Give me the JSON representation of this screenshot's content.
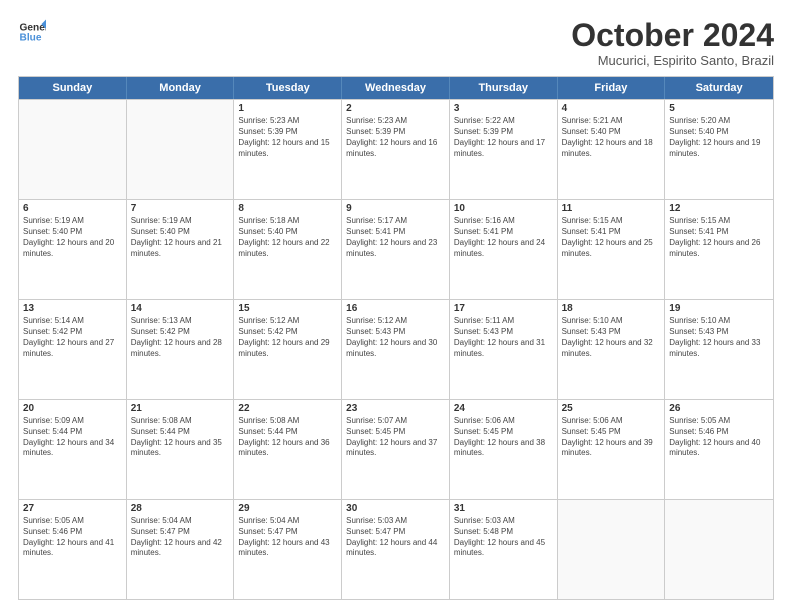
{
  "logo": {
    "line1": "General",
    "line2": "Blue"
  },
  "title": "October 2024",
  "subtitle": "Mucurici, Espirito Santo, Brazil",
  "header_days": [
    "Sunday",
    "Monday",
    "Tuesday",
    "Wednesday",
    "Thursday",
    "Friday",
    "Saturday"
  ],
  "weeks": [
    [
      {
        "day": "",
        "info": ""
      },
      {
        "day": "",
        "info": ""
      },
      {
        "day": "1",
        "info": "Sunrise: 5:23 AM\nSunset: 5:39 PM\nDaylight: 12 hours and 15 minutes."
      },
      {
        "day": "2",
        "info": "Sunrise: 5:23 AM\nSunset: 5:39 PM\nDaylight: 12 hours and 16 minutes."
      },
      {
        "day": "3",
        "info": "Sunrise: 5:22 AM\nSunset: 5:39 PM\nDaylight: 12 hours and 17 minutes."
      },
      {
        "day": "4",
        "info": "Sunrise: 5:21 AM\nSunset: 5:40 PM\nDaylight: 12 hours and 18 minutes."
      },
      {
        "day": "5",
        "info": "Sunrise: 5:20 AM\nSunset: 5:40 PM\nDaylight: 12 hours and 19 minutes."
      }
    ],
    [
      {
        "day": "6",
        "info": "Sunrise: 5:19 AM\nSunset: 5:40 PM\nDaylight: 12 hours and 20 minutes."
      },
      {
        "day": "7",
        "info": "Sunrise: 5:19 AM\nSunset: 5:40 PM\nDaylight: 12 hours and 21 minutes."
      },
      {
        "day": "8",
        "info": "Sunrise: 5:18 AM\nSunset: 5:40 PM\nDaylight: 12 hours and 22 minutes."
      },
      {
        "day": "9",
        "info": "Sunrise: 5:17 AM\nSunset: 5:41 PM\nDaylight: 12 hours and 23 minutes."
      },
      {
        "day": "10",
        "info": "Sunrise: 5:16 AM\nSunset: 5:41 PM\nDaylight: 12 hours and 24 minutes."
      },
      {
        "day": "11",
        "info": "Sunrise: 5:15 AM\nSunset: 5:41 PM\nDaylight: 12 hours and 25 minutes."
      },
      {
        "day": "12",
        "info": "Sunrise: 5:15 AM\nSunset: 5:41 PM\nDaylight: 12 hours and 26 minutes."
      }
    ],
    [
      {
        "day": "13",
        "info": "Sunrise: 5:14 AM\nSunset: 5:42 PM\nDaylight: 12 hours and 27 minutes."
      },
      {
        "day": "14",
        "info": "Sunrise: 5:13 AM\nSunset: 5:42 PM\nDaylight: 12 hours and 28 minutes."
      },
      {
        "day": "15",
        "info": "Sunrise: 5:12 AM\nSunset: 5:42 PM\nDaylight: 12 hours and 29 minutes."
      },
      {
        "day": "16",
        "info": "Sunrise: 5:12 AM\nSunset: 5:43 PM\nDaylight: 12 hours and 30 minutes."
      },
      {
        "day": "17",
        "info": "Sunrise: 5:11 AM\nSunset: 5:43 PM\nDaylight: 12 hours and 31 minutes."
      },
      {
        "day": "18",
        "info": "Sunrise: 5:10 AM\nSunset: 5:43 PM\nDaylight: 12 hours and 32 minutes."
      },
      {
        "day": "19",
        "info": "Sunrise: 5:10 AM\nSunset: 5:43 PM\nDaylight: 12 hours and 33 minutes."
      }
    ],
    [
      {
        "day": "20",
        "info": "Sunrise: 5:09 AM\nSunset: 5:44 PM\nDaylight: 12 hours and 34 minutes."
      },
      {
        "day": "21",
        "info": "Sunrise: 5:08 AM\nSunset: 5:44 PM\nDaylight: 12 hours and 35 minutes."
      },
      {
        "day": "22",
        "info": "Sunrise: 5:08 AM\nSunset: 5:44 PM\nDaylight: 12 hours and 36 minutes."
      },
      {
        "day": "23",
        "info": "Sunrise: 5:07 AM\nSunset: 5:45 PM\nDaylight: 12 hours and 37 minutes."
      },
      {
        "day": "24",
        "info": "Sunrise: 5:06 AM\nSunset: 5:45 PM\nDaylight: 12 hours and 38 minutes."
      },
      {
        "day": "25",
        "info": "Sunrise: 5:06 AM\nSunset: 5:45 PM\nDaylight: 12 hours and 39 minutes."
      },
      {
        "day": "26",
        "info": "Sunrise: 5:05 AM\nSunset: 5:46 PM\nDaylight: 12 hours and 40 minutes."
      }
    ],
    [
      {
        "day": "27",
        "info": "Sunrise: 5:05 AM\nSunset: 5:46 PM\nDaylight: 12 hours and 41 minutes."
      },
      {
        "day": "28",
        "info": "Sunrise: 5:04 AM\nSunset: 5:47 PM\nDaylight: 12 hours and 42 minutes."
      },
      {
        "day": "29",
        "info": "Sunrise: 5:04 AM\nSunset: 5:47 PM\nDaylight: 12 hours and 43 minutes."
      },
      {
        "day": "30",
        "info": "Sunrise: 5:03 AM\nSunset: 5:47 PM\nDaylight: 12 hours and 44 minutes."
      },
      {
        "day": "31",
        "info": "Sunrise: 5:03 AM\nSunset: 5:48 PM\nDaylight: 12 hours and 45 minutes."
      },
      {
        "day": "",
        "info": ""
      },
      {
        "day": "",
        "info": ""
      }
    ]
  ]
}
